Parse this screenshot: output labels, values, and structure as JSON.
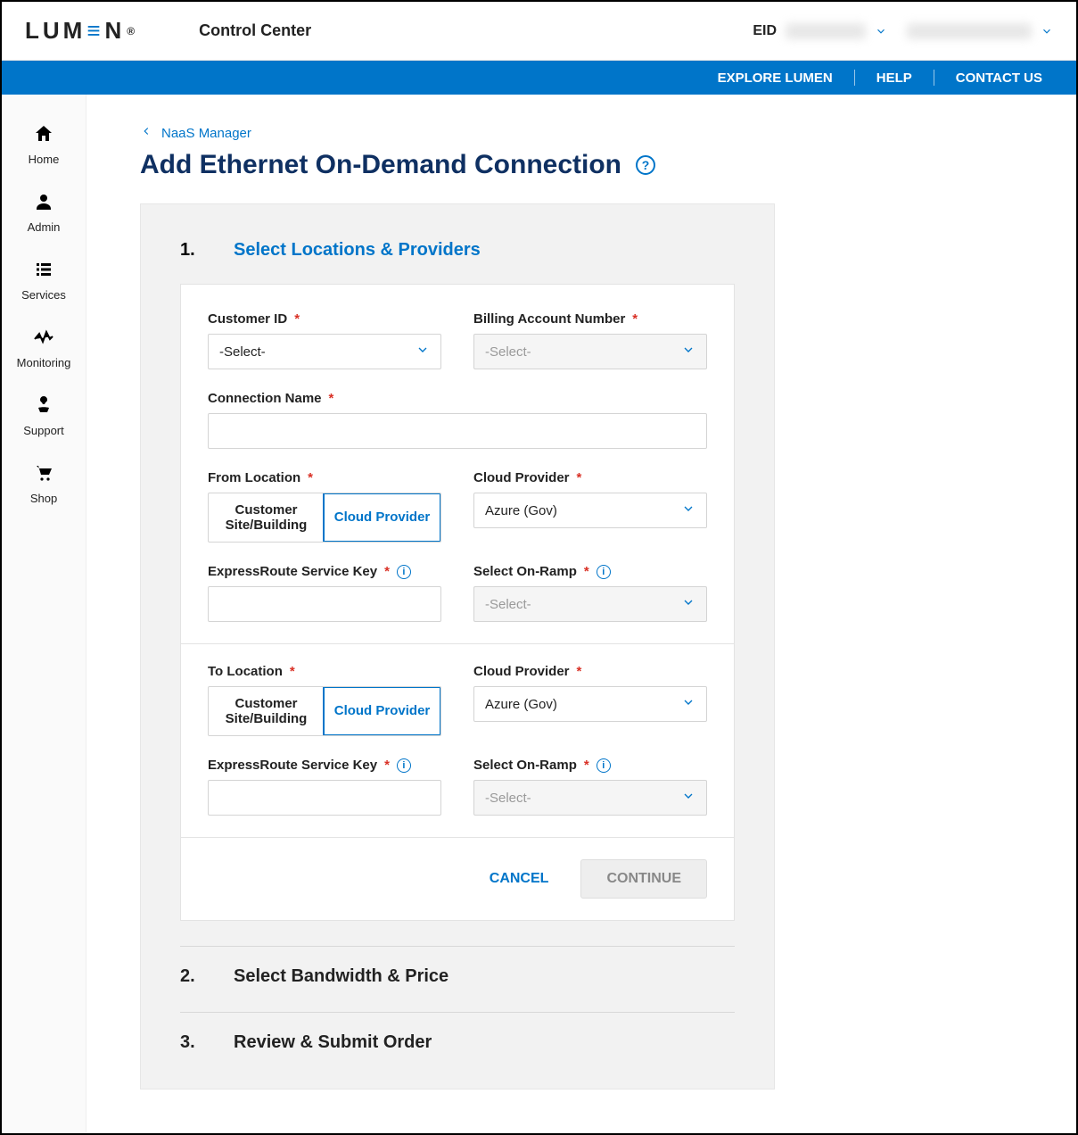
{
  "header": {
    "logo_text": "LUMEN",
    "product": "Control Center",
    "eid_label": "EID"
  },
  "topnav": {
    "explore": "EXPLORE LUMEN",
    "help": "HELP",
    "contact": "CONTACT US"
  },
  "sidebar": {
    "items": [
      {
        "label": "Home",
        "icon": "home-icon"
      },
      {
        "label": "Admin",
        "icon": "user-icon"
      },
      {
        "label": "Services",
        "icon": "list-icon"
      },
      {
        "label": "Monitoring",
        "icon": "monitor-icon"
      },
      {
        "label": "Support",
        "icon": "support-icon"
      },
      {
        "label": "Shop",
        "icon": "cart-icon"
      }
    ]
  },
  "breadcrumb": {
    "back": "NaaS Manager"
  },
  "page": {
    "title": "Add Ethernet On-Demand Connection"
  },
  "wizard": {
    "step1": {
      "num": "1.",
      "label": "Select Locations & Providers"
    },
    "step2": {
      "num": "2.",
      "label": "Select Bandwidth & Price"
    },
    "step3": {
      "num": "3.",
      "label": "Review & Submit Order"
    }
  },
  "form": {
    "customer_id": {
      "label": "Customer ID",
      "value": "-Select-"
    },
    "ban": {
      "label": "Billing Account Number",
      "placeholder": "-Select-"
    },
    "conn_name": {
      "label": "Connection Name"
    },
    "from_location": {
      "label": "From Location",
      "opt_customer": "Customer Site/Building",
      "opt_cloud": "Cloud Provider"
    },
    "from_cloud_provider": {
      "label": "Cloud Provider",
      "value": "Azure (Gov)"
    },
    "from_svc_key": {
      "label": "ExpressRoute Service Key"
    },
    "from_onramp": {
      "label": "Select On-Ramp",
      "placeholder": "-Select-"
    },
    "to_location": {
      "label": "To Location",
      "opt_customer": "Customer Site/Building",
      "opt_cloud": "Cloud Provider"
    },
    "to_cloud_provider": {
      "label": "Cloud Provider",
      "value": "Azure (Gov)"
    },
    "to_svc_key": {
      "label": "ExpressRoute Service Key"
    },
    "to_onramp": {
      "label": "Select On-Ramp",
      "placeholder": "-Select-"
    },
    "actions": {
      "cancel": "CANCEL",
      "continue": "CONTINUE"
    }
  }
}
